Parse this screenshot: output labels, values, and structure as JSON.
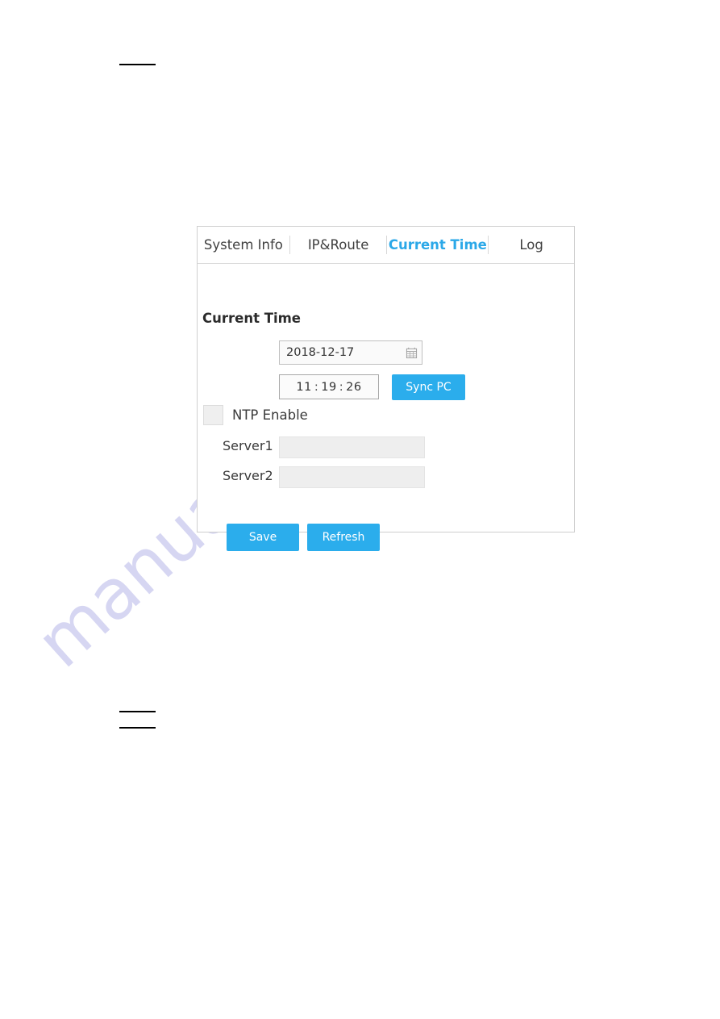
{
  "page": {
    "watermark_text": "manualshive.com",
    "watermark_color": "#d6d6f2",
    "background": "#ffffff",
    "rules": [
      {
        "name": "rule-top"
      },
      {
        "name": "rule-bottom-1"
      },
      {
        "name": "rule-bottom-2"
      }
    ]
  },
  "panel": {
    "accent_color": "#2badec",
    "border_color": "#cfcfcf",
    "tabs": [
      {
        "label": "System Info",
        "active": false
      },
      {
        "label": "IP&Route",
        "active": false
      },
      {
        "label": "Current Time",
        "active": true
      },
      {
        "label": "Log",
        "active": false
      }
    ],
    "section_title": "Current Time",
    "date": {
      "value": "2018-12-17",
      "icon": "calendar-icon"
    },
    "time": {
      "hours": "11",
      "minutes": "19",
      "seconds": "26",
      "separator": ":"
    },
    "sync_button": {
      "label": "Sync PC"
    },
    "ntp": {
      "label": "NTP Enable",
      "checked": false
    },
    "servers": [
      {
        "label": "Server1",
        "value": "",
        "placeholder": ""
      },
      {
        "label": "Server2",
        "value": "",
        "placeholder": ""
      }
    ],
    "actions": {
      "save_label": "Save",
      "refresh_label": "Refresh"
    }
  }
}
